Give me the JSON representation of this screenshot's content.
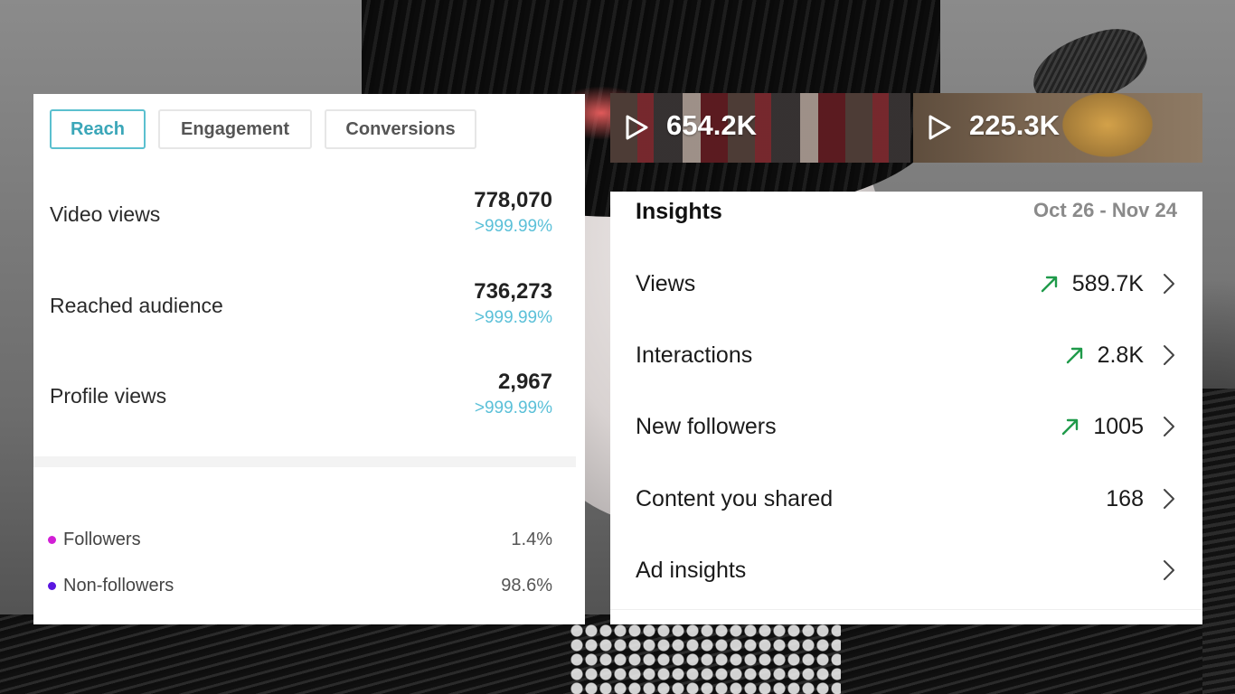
{
  "reach_panel": {
    "tabs": [
      {
        "label": "Reach",
        "active": true
      },
      {
        "label": "Engagement",
        "active": false
      },
      {
        "label": "Conversions",
        "active": false
      }
    ],
    "metrics": [
      {
        "label": "Video views",
        "value": "778,070",
        "change": ">999.99%"
      },
      {
        "label": "Reached audience",
        "value": "736,273",
        "change": ">999.99%"
      },
      {
        "label": "Profile views",
        "value": "2,967",
        "change": ">999.99%"
      }
    ],
    "audience": [
      {
        "label": "Followers",
        "value": "1.4%",
        "dot_color": "#d21fd6"
      },
      {
        "label": "Non-followers",
        "value": "98.6%",
        "dot_color": "#5a16e0"
      }
    ],
    "accent_color": "#5bc0cf"
  },
  "videos": [
    {
      "views": "654.2K",
      "icon": "play-icon"
    },
    {
      "views": "225.3K",
      "icon": "play-icon"
    }
  ],
  "insights": {
    "title": "Insights",
    "date_range": "Oct 26 - Nov 24",
    "rows": [
      {
        "label": "Views",
        "value": "589.7K",
        "trend": "up"
      },
      {
        "label": "Interactions",
        "value": "2.8K",
        "trend": "up"
      },
      {
        "label": "New followers",
        "value": "1005",
        "trend": "up"
      },
      {
        "label": "Content you shared",
        "value": "168",
        "trend": ""
      },
      {
        "label": "Ad insights",
        "value": "",
        "trend": ""
      }
    ],
    "trend_color": "#1f9a4a"
  }
}
